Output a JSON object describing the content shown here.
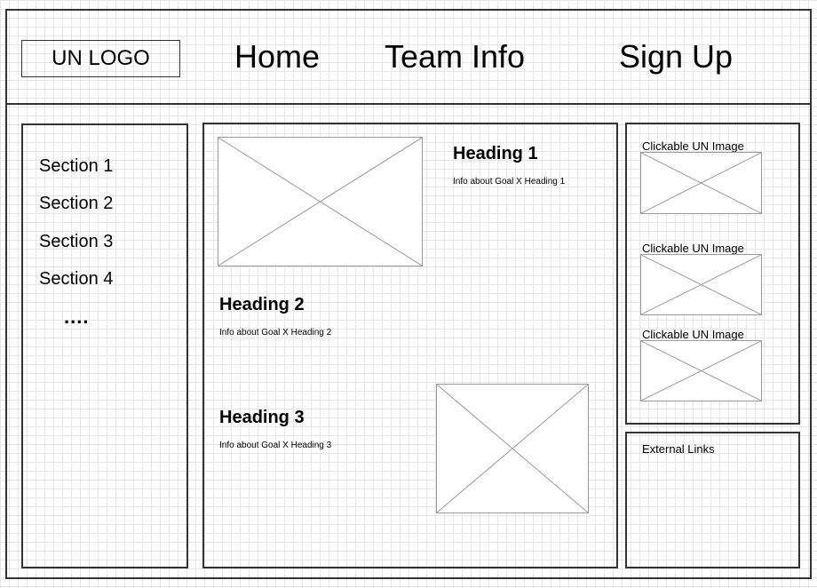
{
  "header": {
    "logo": "UN LOGO",
    "nav": [
      "Home",
      "Team Info",
      "Sign Up"
    ]
  },
  "sidebar": {
    "items": [
      "Section 1",
      "Section 2",
      "Section 3",
      "Section 4"
    ],
    "more": "...."
  },
  "main": {
    "sections": [
      {
        "heading": "Heading 1",
        "info": "Info about Goal X Heading 1"
      },
      {
        "heading": "Heading 2",
        "info": "Info about Goal X Heading 2"
      },
      {
        "heading": "Heading 3",
        "info": "Info about Goal X Heading 3"
      }
    ]
  },
  "right_panel": {
    "images": [
      "Clickable UN Image",
      "Clickable UN Image",
      "Clickable UN Image"
    ],
    "links_label": "External Links"
  }
}
